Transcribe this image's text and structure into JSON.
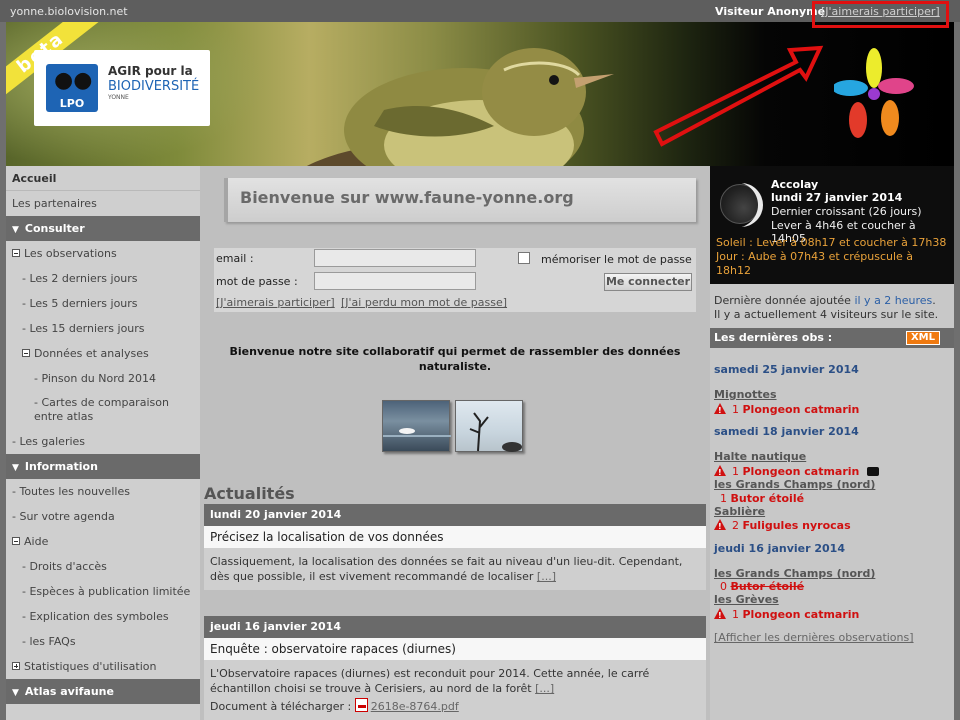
{
  "topbar": {
    "site": "yonne.biolovision.net",
    "visitor": "Visiteur Anonyme",
    "join_link": "[J'aimerais participer]"
  },
  "banner": {
    "beta": "beta",
    "logo_lpo": "LPO",
    "logo_line1": "AGIR pour la",
    "logo_line2": "BIODIVERSITÉ",
    "logo_line3": "YONNE"
  },
  "sidebar": {
    "items": [
      {
        "label": "Accueil"
      },
      {
        "label": "Les partenaires"
      },
      {
        "label": "Consulter"
      },
      {
        "label": "Les observations"
      },
      {
        "label": "- Les 2 derniers jours"
      },
      {
        "label": "- Les 5 derniers jours"
      },
      {
        "label": "- Les 15 derniers jours"
      },
      {
        "label": "Données et analyses"
      },
      {
        "label": "- Pinson du Nord 2014"
      },
      {
        "label": "- Cartes de comparaison entre atlas"
      },
      {
        "label": "- Les galeries"
      },
      {
        "label": "Information"
      },
      {
        "label": "- Toutes les nouvelles"
      },
      {
        "label": "- Sur votre agenda"
      },
      {
        "label": "Aide"
      },
      {
        "label": "- Droits d'accès"
      },
      {
        "label": "- Espèces à publication limitée"
      },
      {
        "label": "- Explication des symboles"
      },
      {
        "label": "- les FAQs"
      },
      {
        "label": "Statistiques d'utilisation"
      },
      {
        "label": "Atlas avifaune"
      }
    ]
  },
  "main": {
    "welcome": "Bienvenue sur www.faune-yonne.org",
    "login": {
      "email_label": "email :",
      "password_label": "mot de passe :",
      "remember_label": "mémoriser le mot de passe",
      "connect_button": "Me connecter",
      "join_link": "[J'aimerais participer]",
      "lost_link": "[J'ai perdu mon mot de passe]"
    },
    "intro": "Bienvenue notre site collaboratif qui permet de rassembler des données naturaliste.",
    "news_heading": "Actualités",
    "news": [
      {
        "date": "lundi 20 janvier 2014",
        "title": "Précisez la localisation de vos données",
        "body": "Classiquement, la localisation des données se fait au niveau d'un lieu-dit. Cependant, dès que possible, il est vivement recommandé de localiser",
        "more": "[...]"
      },
      {
        "date": "jeudi 16 janvier 2014",
        "title": "Enquête : observatoire rapaces (diurnes)",
        "body": "L'Observatoire rapaces (diurnes) est reconduit pour 2014. Cette année, le carré échantillon choisi se trouve à Cerisiers, au nord de la forêt",
        "more": "[...]",
        "doc_label": "Document à télécharger :",
        "doc_file": "2618e-8764.pdf"
      }
    ]
  },
  "right": {
    "town": "Accolay",
    "date": "lundi 27 janvier 2014",
    "moon_phase": "Dernier croissant (26 jours)",
    "moon_rise": "Lever à 4h46 et coucher à 14h05",
    "sun": "Soleil : Lever à 08h17 et coucher à 17h38",
    "day": "Jour : Aube à 07h43 et crépuscule à 18h12",
    "last_added_prefix": "Dernière donnée ajoutée",
    "last_added_link": "il y a 2 heures",
    "last_added_suffix": ".",
    "visitors": "Il y a actuellement 4 visiteurs sur le site.",
    "obs_heading": "Les dernières obs :",
    "xml": "XML",
    "obs": {
      "d1": "samedi 25 janvier 2014",
      "p1": "Mignottes",
      "c1": "1",
      "s1": "Plongeon catmarin",
      "d2": "samedi 18 janvier 2014",
      "p2": "Halte nautique",
      "c2": "1",
      "s2": "Plongeon catmarin",
      "p3": "les Grands Champs (nord)",
      "c3": "1",
      "s3": "Butor étoilé",
      "p4": "Sablière",
      "c4": "2",
      "s4": "Fuligules nyrocas",
      "d3": "jeudi 16 janvier 2014",
      "p5": "les Grands Champs (nord)",
      "c5": "0",
      "s5": "Butor étoilé",
      "p6": "les Grèves",
      "c6": "1",
      "s6": "Plongeon catmarin",
      "all": "[Afficher les dernières observations]"
    }
  }
}
